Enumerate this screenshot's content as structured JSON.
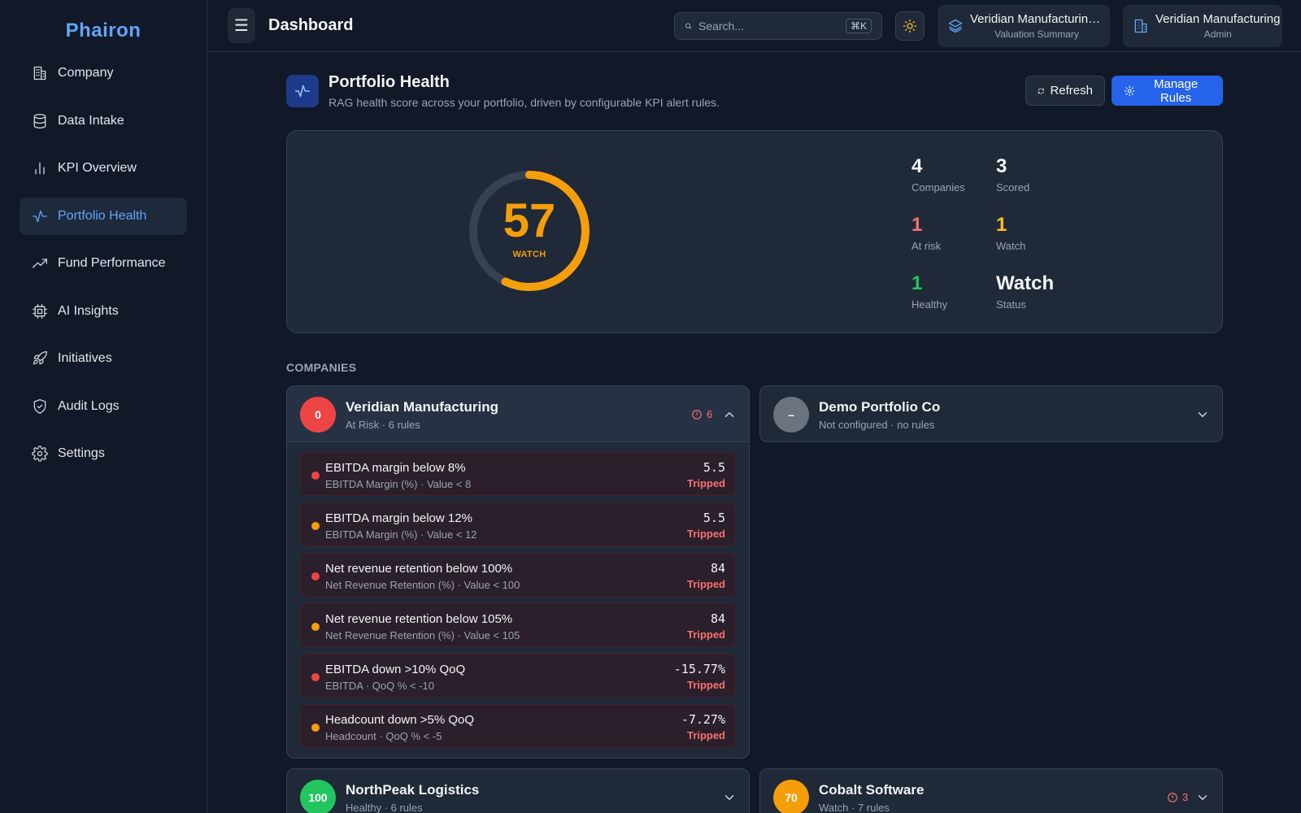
{
  "app": {
    "brand": "Phairon"
  },
  "sidebar": {
    "items": [
      {
        "label": "Company",
        "icon": "building-icon"
      },
      {
        "label": "Data Intake",
        "icon": "database-icon"
      },
      {
        "label": "KPI Overview",
        "icon": "bar-chart-icon"
      },
      {
        "label": "Portfolio Health",
        "icon": "activity-icon",
        "active": true
      },
      {
        "label": "Fund Performance",
        "icon": "trending-up-icon"
      },
      {
        "label": "AI Insights",
        "icon": "cpu-icon"
      },
      {
        "label": "Initiatives",
        "icon": "rocket-icon"
      },
      {
        "label": "Audit Logs",
        "icon": "shield-check-icon"
      },
      {
        "label": "Settings",
        "icon": "gear-icon"
      }
    ]
  },
  "topbar": {
    "menu_glyph": "☰",
    "title": "Dashboard",
    "search_placeholder": "Search...",
    "search_shortcut": "⌘K",
    "context": {
      "main": "Veridian Manufacturing…",
      "sub": "Valuation Summary"
    },
    "org": {
      "main": "Veridian Manufacturing",
      "sub": "Admin"
    }
  },
  "page": {
    "title": "Portfolio Health",
    "subtitle": "RAG health score across your portfolio, driven by configurable KPI alert rules.",
    "refresh_label": "Refresh",
    "manage_label": "Manage Rules"
  },
  "summary": {
    "score": 57,
    "score_label": "WATCH",
    "score_max": 100,
    "stats": {
      "companies": {
        "value": "4",
        "label": "Companies"
      },
      "scored": {
        "value": "3",
        "label": "Scored"
      },
      "at_risk": {
        "value": "1",
        "label": "At risk"
      },
      "watch": {
        "value": "1",
        "label": "Watch"
      },
      "healthy": {
        "value": "1",
        "label": "Healthy"
      },
      "status": {
        "value": "Watch",
        "label": "Status"
      }
    }
  },
  "companies_section": {
    "title": "COMPANIES",
    "cards": {
      "veridian": {
        "score": "0",
        "name": "Veridian Manufacturing",
        "sub": "At Risk · 6 rules",
        "alerts": "6",
        "rules": [
          {
            "name": "EBITDA margin below 8%",
            "desc": "EBITDA Margin (%) · Value < 8",
            "value": "5.5",
            "status": "Tripped",
            "severity": "red"
          },
          {
            "name": "EBITDA margin below 12%",
            "desc": "EBITDA Margin (%) · Value < 12",
            "value": "5.5",
            "status": "Tripped",
            "severity": "amber"
          },
          {
            "name": "Net revenue retention below 100%",
            "desc": "Net Revenue Retention (%) · Value < 100",
            "value": "84",
            "status": "Tripped",
            "severity": "red"
          },
          {
            "name": "Net revenue retention below 105%",
            "desc": "Net Revenue Retention (%) · Value < 105",
            "value": "84",
            "status": "Tripped",
            "severity": "amber"
          },
          {
            "name": "EBITDA down >10% QoQ",
            "desc": "EBITDA · QoQ % < -10",
            "value": "-15.77%",
            "status": "Tripped",
            "severity": "red"
          },
          {
            "name": "Headcount down >5% QoQ",
            "desc": "Headcount · QoQ % < -5",
            "value": "-7.27%",
            "status": "Tripped",
            "severity": "amber"
          }
        ]
      },
      "demo": {
        "score": "–",
        "name": "Demo Portfolio Co",
        "sub": "Not configured · no rules"
      },
      "northpeak": {
        "score": "100",
        "name": "NorthPeak Logistics",
        "sub": "Healthy · 6 rules"
      },
      "cobalt": {
        "score": "70",
        "name": "Cobalt Software",
        "sub": "Watch · 7 rules",
        "alerts": "3"
      }
    }
  },
  "colors": {
    "accent": "#2563eb",
    "brand": "#60a5fa",
    "red": "#ef4444",
    "amber": "#f59e0b",
    "green": "#22c55e",
    "gray": "#6b7280"
  }
}
